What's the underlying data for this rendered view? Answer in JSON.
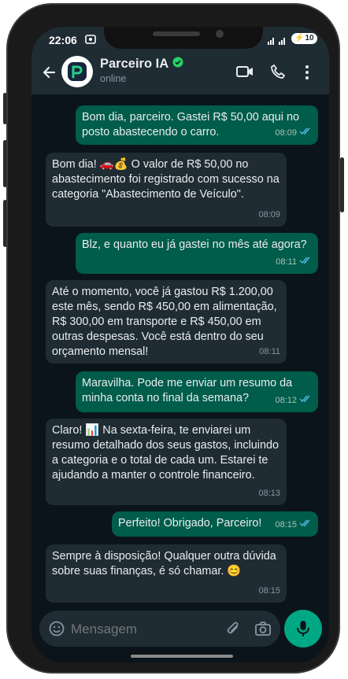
{
  "status": {
    "time": "22:06",
    "battery": "10"
  },
  "contact": {
    "name": "Parceiro IA",
    "status": "online"
  },
  "messages": [
    {
      "dir": "out",
      "text": "Bom dia, parceiro. Gastei R$ 50,00 aqui no posto abastecendo o carro.",
      "time": "08:09"
    },
    {
      "dir": "in",
      "text": "Bom dia! 🚗💰 O valor de R$ 50,00 no abastecimento foi registrado com sucesso na categoria \"Abastecimento de Veículo\".",
      "time": "08:09"
    },
    {
      "dir": "out",
      "text": "Blz, e quanto eu já gastei no mês até agora?",
      "time": "08:11"
    },
    {
      "dir": "in",
      "text": "Até o momento, você já gastou R$ 1.200,00 este mês, sendo R$ 450,00 em alimentação, R$ 300,00 em transporte e R$ 450,00 em outras despesas. Você está dentro do seu orçamento mensal!",
      "time": "08:11"
    },
    {
      "dir": "out",
      "text": "Maravilha. Pode me enviar um resumo da minha conta no final da semana?",
      "time": "08:12"
    },
    {
      "dir": "in",
      "text": "Claro! 📊 Na sexta-feira, te enviarei um resumo detalhado dos seus gastos, incluindo a categoria e o total de cada um. Estarei te ajudando a manter o controle financeiro.",
      "time": "08:13"
    },
    {
      "dir": "out",
      "text": "Perfeito! Obrigado, Parceiro!",
      "time": "08:15"
    },
    {
      "dir": "in",
      "text": "Sempre à disposição! Qualquer outra dúvida sobre suas finanças, é só chamar. 😊",
      "time": "08:15"
    }
  ],
  "input": {
    "placeholder": "Mensagem"
  },
  "colors": {
    "header": "#1f2c34",
    "background": "#0b141a",
    "outgoing": "#005c4b",
    "incoming": "#202c33",
    "accent": "#00a884",
    "read_ticks": "#53bdeb"
  }
}
